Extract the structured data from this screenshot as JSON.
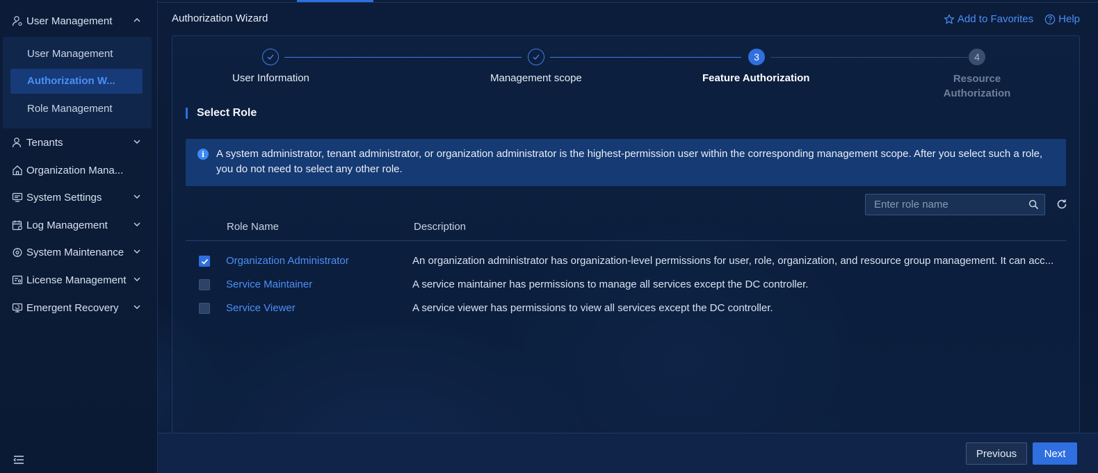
{
  "colors": {
    "accent": "#2f6fe0",
    "link": "#4b8ff7",
    "background": "#0b1a35",
    "info_bg": "#163a73"
  },
  "sidebar": {
    "groups": [
      {
        "label": "User Management",
        "icon": "user-icon",
        "expanded": true
      },
      {
        "label": "Tenants",
        "icon": "tenants-icon"
      },
      {
        "label": "Organization Mana...",
        "icon": "home-icon"
      },
      {
        "label": "System Settings",
        "icon": "settings-screen-icon"
      },
      {
        "label": "Log Management",
        "icon": "log-calendar-icon"
      },
      {
        "label": "System Maintenance",
        "icon": "maintenance-icon"
      },
      {
        "label": "License Management",
        "icon": "license-icon"
      },
      {
        "label": "Emergent Recovery",
        "icon": "recovery-icon"
      }
    ],
    "submenu": [
      {
        "label": "User Management"
      },
      {
        "label": "Authorization W...",
        "active": true
      },
      {
        "label": "Role Management"
      }
    ],
    "collapse_icon": "collapse-menu-icon"
  },
  "header": {
    "title": "Authorization Wizard",
    "favorites": "Add to Favorites",
    "help": "Help"
  },
  "steps": [
    {
      "number": "1",
      "label": "User Information",
      "state": "done"
    },
    {
      "number": "2",
      "label": "Management scope",
      "state": "done"
    },
    {
      "number": "3",
      "label": "Feature Authorization",
      "state": "current"
    },
    {
      "number": "4",
      "label_line1": "Resource",
      "label_line2": "Authorization",
      "state": "future"
    }
  ],
  "section": {
    "title": "Select Role"
  },
  "info": {
    "text": "A system administrator, tenant administrator, or organization administrator is the highest-permission user within the corresponding management scope. After you select such a role, you do not need to select any other role."
  },
  "search": {
    "placeholder": "Enter role name",
    "value": ""
  },
  "table": {
    "columns": [
      "Role Name",
      "Description"
    ],
    "rows": [
      {
        "checked": true,
        "name": "Organization Administrator",
        "description": "An organization administrator has organization-level permissions for user, role, organization, and resource group management. It can acc..."
      },
      {
        "checked": false,
        "name": "Service Maintainer",
        "description": "A service maintainer has permissions to manage all services except the DC controller."
      },
      {
        "checked": false,
        "name": "Service Viewer",
        "description": "A service viewer has permissions to view all services except the DC controller."
      }
    ]
  },
  "footer": {
    "previous": "Previous",
    "next": "Next"
  }
}
